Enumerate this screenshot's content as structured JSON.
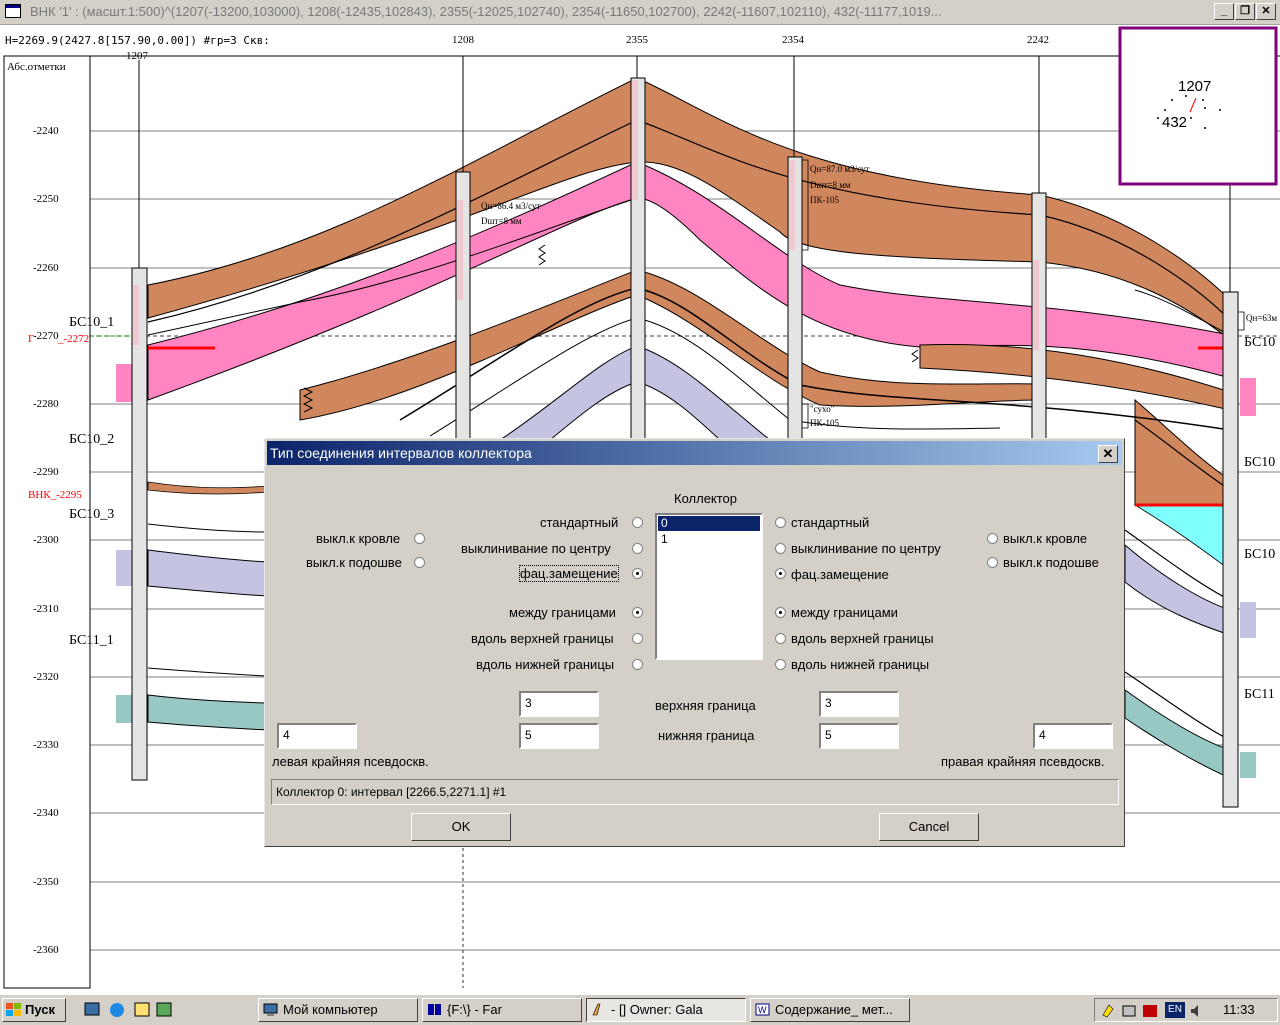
{
  "window": {
    "title": "ВНК '1' : (масшт.1:500)^(1207(-13200,103000), 1208(-12435,102843), 2355(-12025,102740), 2354(-11650,102700), 2242(-11607,102110), 432(-11177,1019...",
    "min_label": "_",
    "max_label": "❐",
    "close_label": "✕"
  },
  "header": {
    "info": "H=2269.9(2427.8[157.90,0.00])  #гр=3 Скв:",
    "axis_title": "Абс.отметки",
    "wells": [
      "1207",
      "1208",
      "2355",
      "2354",
      "2242"
    ]
  },
  "depth_ticks": [
    "-2240",
    "-2250",
    "-2260",
    "-2270",
    "-2280",
    "-2290",
    "-2300",
    "-2310",
    "-2320",
    "-2330",
    "-2340",
    "-2350",
    "-2360"
  ],
  "markers": {
    "red_top": "_-2272",
    "vnk": "ВНК_-2295",
    "vnk_prefix": "Г"
  },
  "layers": {
    "left": [
      "БС10_1",
      "БС10_2",
      "БС10_3",
      "БС11_1"
    ],
    "right": [
      "БС10",
      "БС10",
      "БС10",
      "БС11"
    ]
  },
  "annotations": {
    "a1": "Qн=86.4 м3/сут",
    "a2": "Dшт=8 мм",
    "b1": "Qн=87.0 м3/сут",
    "b2": "Dшт=8 мм",
    "b3": "ПК-105",
    "c1": "\"сухо\"",
    "c2": "ПК-105",
    "d1": "Qн=63м"
  },
  "minimap": {
    "well_top": "1207",
    "well_bottom": "432"
  },
  "colors": {
    "brown": "#d0875e",
    "pink": "#ff85c2",
    "lavender": "#c4c4e2",
    "teal": "#98c8c4",
    "cyan": "#80ffff",
    "red_line": "#ff0000",
    "minimap_border": "#800080"
  },
  "dialog": {
    "title": "Тип соединения интервалов коллектора",
    "close": "✕",
    "collector_header": "Коллектор",
    "list_items": [
      "0",
      "1"
    ],
    "left_outer": [
      "выкл.к кровле",
      "выкл.к подошве"
    ],
    "left_mid_top": [
      "стандартный",
      "выклинивание по центру",
      "фац.замещение"
    ],
    "left_mid_bottom": [
      "между границами",
      "вдоль верхней границы",
      "вдоль нижней границы"
    ],
    "right_mid_top": [
      "стандартный",
      "выклинивание по центру",
      "фац.замещение"
    ],
    "right_mid_bottom": [
      "между границами",
      "вдоль верхней границы",
      "вдоль нижней границы"
    ],
    "right_outer": [
      "выкл.к кровле",
      "выкл.к подошве"
    ],
    "upper_boundary_label": "верхняя граница",
    "lower_boundary_label": "нижняя граница",
    "upper_left": "3",
    "lower_left": "5",
    "upper_right": "3",
    "lower_right": "5",
    "left_pseudo_value": "4",
    "right_pseudo_value": "4",
    "left_pseudo_label": "левая крайняя псевдоскв.",
    "right_pseudo_label": "правая крайняя псевдоскв.",
    "status": "Коллектор 0: интервал [2266.5,2271.1] #1",
    "ok": "OK",
    "cancel": "Cancel"
  },
  "taskbar": {
    "start": "Пуск",
    "tasks": [
      "Мой компьютер",
      "{F:\\} - Far",
      "- [] Owner: Gala",
      "Содержание_ мет..."
    ],
    "lang": "EN",
    "clock": "11:33"
  }
}
